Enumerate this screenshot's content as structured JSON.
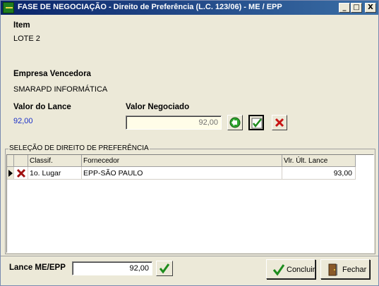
{
  "window": {
    "title": "FASE DE NEGOCIAÇÃO - Direito de Preferência (L.C. 123/06) - ME / EPP",
    "controls": {
      "minimize": "_",
      "maximize": "□",
      "close": "X"
    }
  },
  "item": {
    "label": "Item",
    "value": "LOTE 2"
  },
  "empresa": {
    "label": "Empresa Vencedora",
    "value": "SMARAPD INFORMÁTICA"
  },
  "valor_lance": {
    "label": "Valor do Lance",
    "value": "92,00"
  },
  "valor_negociado": {
    "label": "Valor Negociado",
    "value": "92,00"
  },
  "group": {
    "title": "SELEÇÃO DE DIREITO DE PREFERÊNCIA"
  },
  "grid": {
    "columns": [
      "Classif.",
      "Fornecedor",
      "Vlr. Últ. Lance"
    ],
    "rows": [
      {
        "classif": "1o. Lugar",
        "fornecedor": "EPP-SÃO PAULO",
        "valor": "93,00"
      }
    ]
  },
  "lance": {
    "label": "Lance ME/EPP",
    "value": "92,00"
  },
  "buttons": {
    "concluir": "Concluir",
    "fechar": "Fechar"
  },
  "colors": {
    "window_bg": "#ece9d8",
    "title_bar": "#0a246a",
    "value_blue": "#1a2fc8",
    "field_bg": "#fffde8"
  },
  "icons": {
    "back": "green-arrow-left-icon",
    "confirm": "green-check-icon",
    "cancel": "red-x-icon",
    "concluir": "green-check-icon",
    "fechar": "door-exit-icon"
  }
}
